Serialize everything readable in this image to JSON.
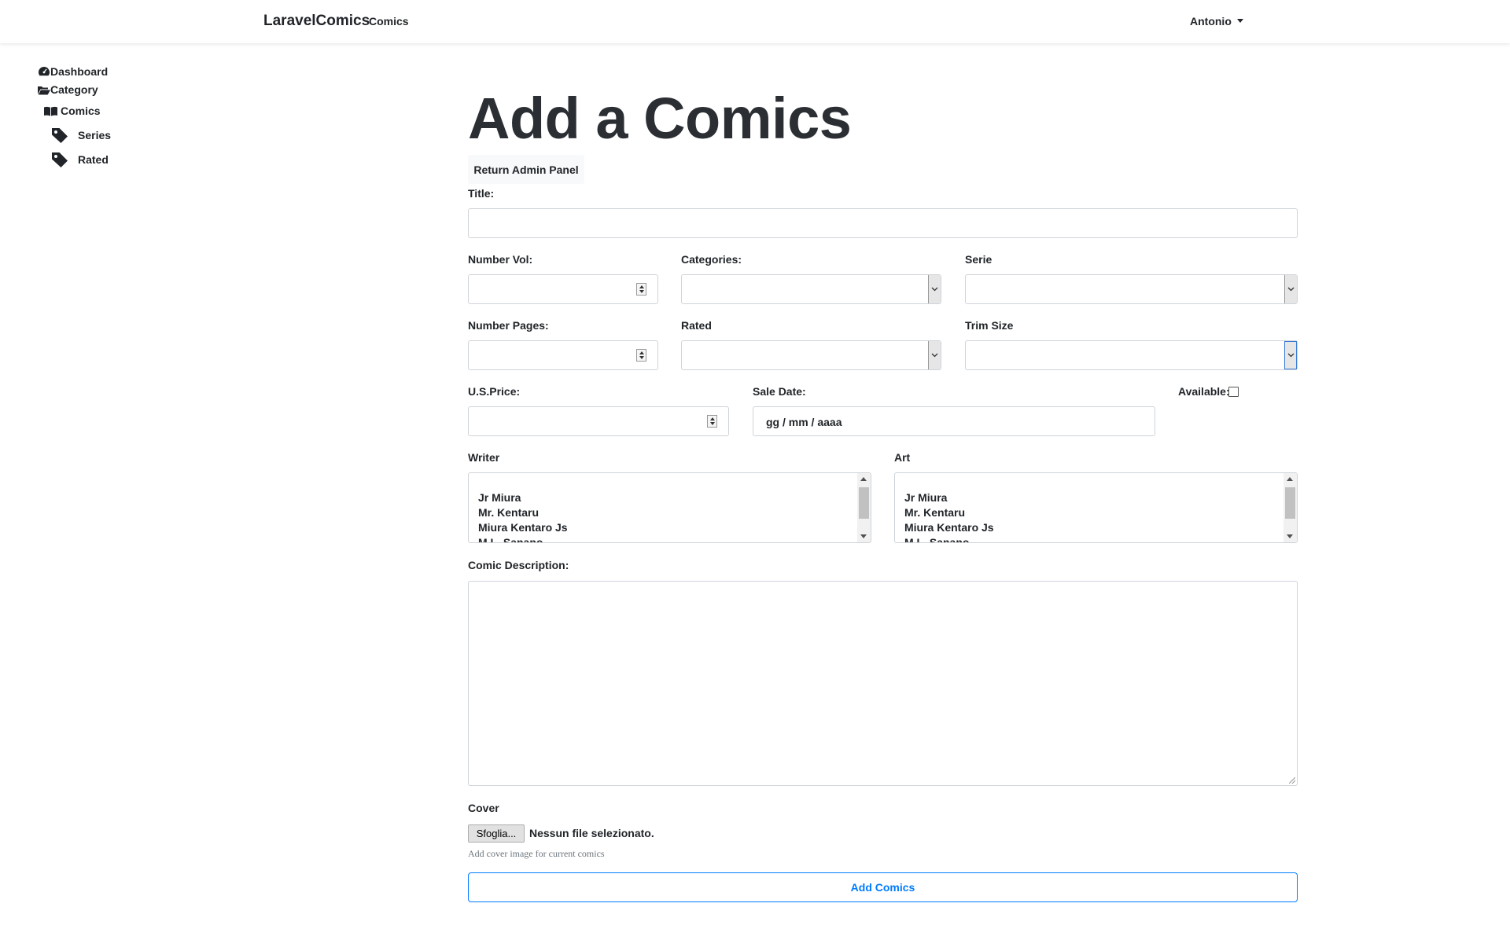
{
  "navbar": {
    "brand": "LaravelComics",
    "link_comics": "Comics",
    "user": "Antonio"
  },
  "sidebar": {
    "items": [
      {
        "label": "Dashboard",
        "icon": "tachometer-icon"
      },
      {
        "label": "Category",
        "icon": "folder-open-icon"
      },
      {
        "label": "Comics",
        "icon": "book-open-icon"
      },
      {
        "label": "Series",
        "icon": "tag-icon"
      },
      {
        "label": "Rated",
        "icon": "tag-icon"
      }
    ]
  },
  "main": {
    "title": "Add a Comics",
    "return_button": "Return Admin Panel"
  },
  "form": {
    "title_label": "Title:",
    "title_value": "",
    "number_vol_label": "Number Vol:",
    "categories_label": "Categories:",
    "serie_label": "Serie",
    "number_pages_label": "Number Pages:",
    "rated_label": "Rated",
    "trim_size_label": "Trim Size",
    "price_label": "U.S.Price:",
    "sale_date_label": "Sale Date:",
    "sale_date_placeholder": "gg / mm / aaaa",
    "available_label": "Available:",
    "available_checked": false,
    "writer_label": "Writer",
    "writer_options": [
      "Jr Miura",
      "Mr. Kentaru",
      "Miura Kentaro Js",
      "M.L. Sanano"
    ],
    "art_label": "Art",
    "art_options": [
      "Jr Miura",
      "Mr. Kentaru",
      "Miura Kentaro Js",
      "M.L. Sanano"
    ],
    "description_label": "Comic Description:",
    "cover_label": "Cover",
    "file_button": "Sfoglia...",
    "file_status": "Nessun file selezionato.",
    "cover_help": "Add cover image for current comics",
    "submit_button": "Add Comics"
  },
  "colors": {
    "primary": "#007bff",
    "text": "#212529",
    "border": "#ced4da"
  }
}
